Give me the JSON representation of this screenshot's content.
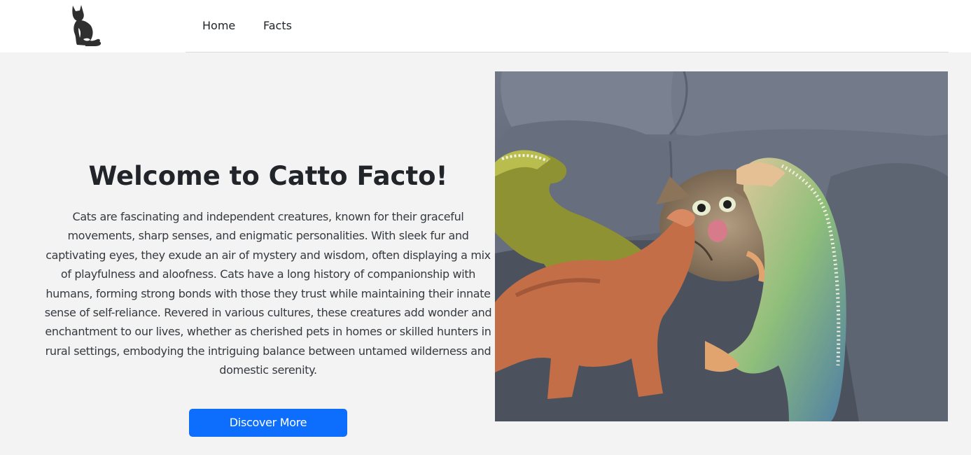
{
  "navbar": {
    "logo_icon": "cat-silhouette-icon",
    "links": [
      {
        "label": "Home"
      },
      {
        "label": "Facts"
      }
    ]
  },
  "hero": {
    "title": "Welcome to Catto Facto!",
    "description": "Cats are fascinating and independent creatures, known for their graceful movements, sharp senses, and enigmatic personalities. With sleek fur and captivating eyes, they exude an air of mystery and wisdom, often displaying a mix of playfulness and aloofness. Cats have a long history of companionship with humans, forming strong bonds with those they trust while maintaining their innate sense of self-reliance. Revered in various cultures, these creatures add wonder and enchantment to our lives, whether as cherished pets in homes or skilled hunters in rural settings, embodying the intriguing balance between untamed wilderness and domestic serenity.",
    "button_label": "Discover More",
    "image": "photo of a surprised tabby cat surrounded by toy dinosaurs on a grey couch"
  },
  "colors": {
    "accent": "#0d6efd",
    "page_background": "#f3f3f3",
    "navbar_background": "#ffffff"
  }
}
